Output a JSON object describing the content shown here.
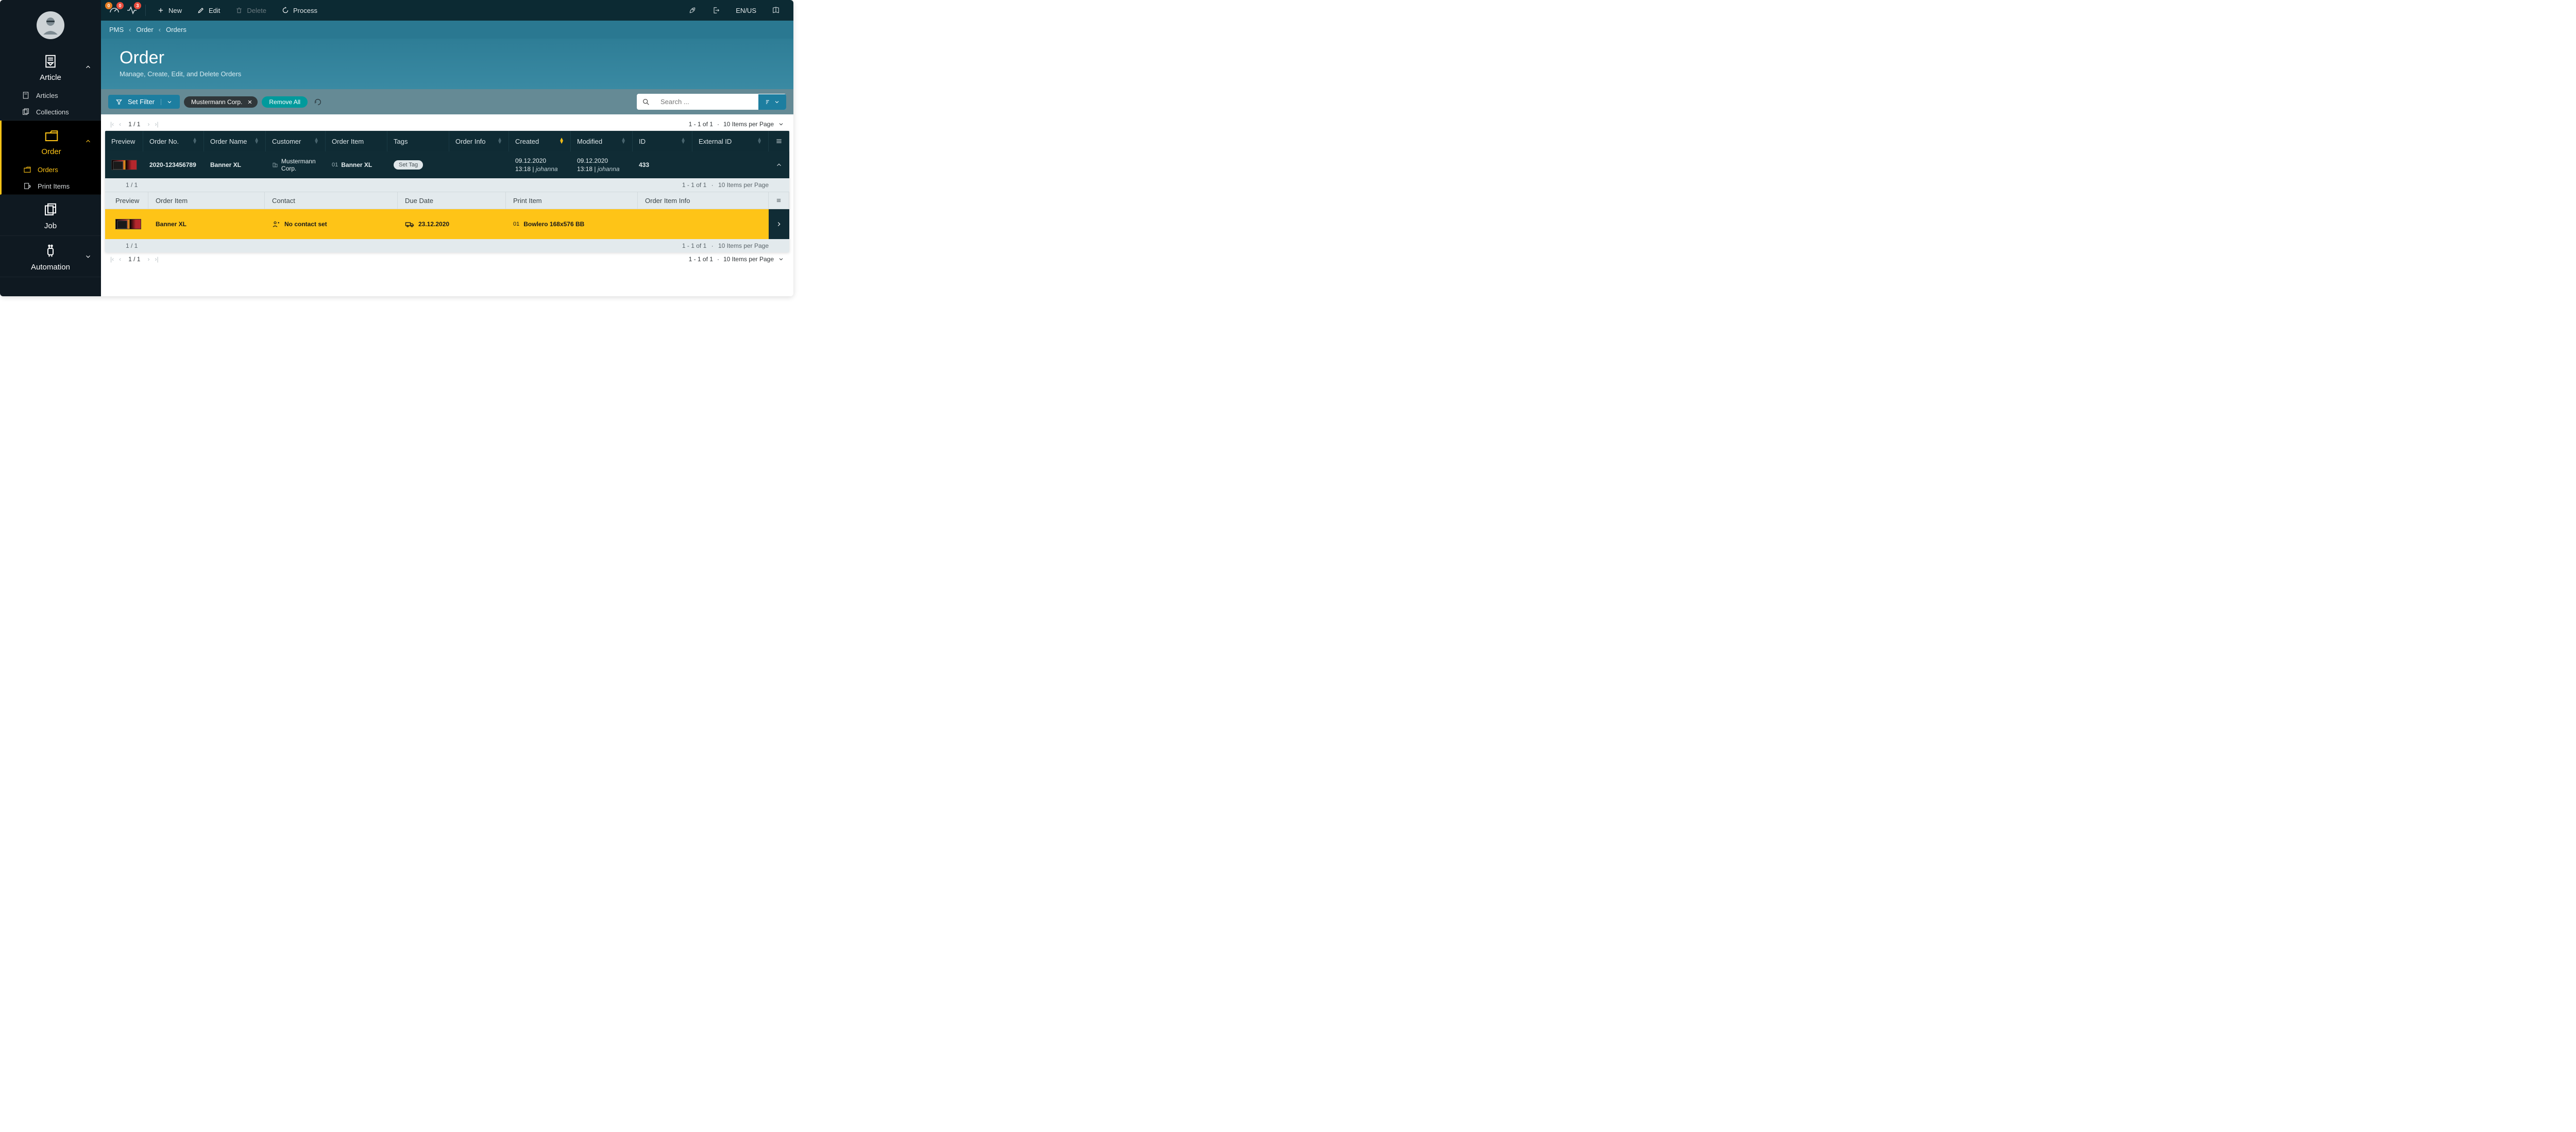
{
  "topbar": {
    "gauge1_badge": "0",
    "gauge1_badge_r": "0",
    "gauge2_badge": "3",
    "new_label": "New",
    "edit_label": "Edit",
    "delete_label": "Delete",
    "process_label": "Process",
    "lang_label": "EN/US"
  },
  "breadcrumb": {
    "a": "PMS",
    "b": "Order",
    "c": "Orders"
  },
  "page": {
    "title": "Order",
    "subtitle": "Manage, Create, Edit, and Delete Orders"
  },
  "filter": {
    "set_filter_label": "Set Filter",
    "chip1": "Mustermann Corp.",
    "remove_all": "Remove All",
    "search_placeholder": "Search ..."
  },
  "sidebar": {
    "article": {
      "label": "Article",
      "items": [
        "Articles",
        "Collections"
      ]
    },
    "order": {
      "label": "Order",
      "items": [
        "Orders",
        "Print Items"
      ]
    },
    "job": {
      "label": "Job"
    },
    "automation": {
      "label": "Automation"
    }
  },
  "pager": {
    "page_text": "1 / 1",
    "range_text": "1 - 1 of 1",
    "sep": "·",
    "per_page": "10  Items per Page"
  },
  "table": {
    "headers": {
      "preview": "Preview",
      "order_no": "Order No.",
      "order_name": "Order Name",
      "customer": "Customer",
      "order_item": "Order Item",
      "tags": "Tags",
      "order_info": "Order Info",
      "created": "Created",
      "modified": "Modified",
      "id": "ID",
      "external_id": "External ID"
    },
    "row": {
      "order_no": "2020-123456789",
      "order_name": "Banner XL",
      "customer": "Mustermann Corp.",
      "order_item_num": "01",
      "order_item_name": "Banner XL",
      "set_tag": "Set Tag",
      "created_date": "09.12.2020",
      "created_time_prefix": "13:18 | ",
      "created_user": "johanna",
      "modified_date": "09.12.2020",
      "modified_time_prefix": "13:18 | ",
      "modified_user": "johanna",
      "id": "433"
    }
  },
  "subtable": {
    "pager": {
      "page_text": "1 / 1",
      "range_text": "1 - 1 of 1",
      "sep": "·",
      "per_page": "10  Items per Page"
    },
    "headers": {
      "preview": "Preview",
      "order_item": "Order Item",
      "contact": "Contact",
      "due_date": "Due Date",
      "print_item": "Print Item",
      "order_item_info": "Order Item Info"
    },
    "row": {
      "order_item": "Banner XL",
      "contact": "No contact set",
      "due_date": "23.12.2020",
      "print_item_num": "01",
      "print_item_name": "Bowlero 168x576 BB"
    }
  }
}
